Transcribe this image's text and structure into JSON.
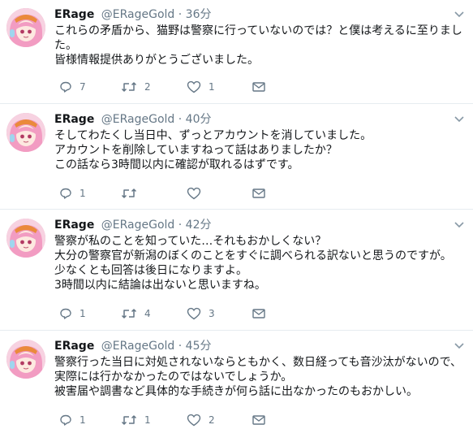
{
  "tweets": [
    {
      "name": "ERage",
      "handle": "@ERageGold",
      "dot": "·",
      "time": "36分",
      "lines": [
        "これらの矛盾から、猫野は警察に行っていないのでは？と僕は考えるに至りまし",
        "た。",
        "皆様情報提供ありがとうございました。"
      ],
      "replies": "7",
      "retweets": "2",
      "likes": "1"
    },
    {
      "name": "ERage",
      "handle": "@ERageGold",
      "dot": "·",
      "time": "40分",
      "lines": [
        "そしてわたくし当日中、ずっとアカウントを消していました。",
        "アカウントを削除していますねって話はありましたか？",
        "この話なら3時間以内に確認が取れるはずです。"
      ],
      "replies": "1",
      "retweets": "",
      "likes": ""
    },
    {
      "name": "ERage",
      "handle": "@ERageGold",
      "dot": "·",
      "time": "42分",
      "lines": [
        "警察が私のことを知っていた…それもおかしくない？",
        "大分の警察官が新潟のぼくのことをすぐに調べられる訳ないと思うのですが。",
        "少なくとも回答は後日になりますよ。",
        "3時間以内に結論は出ないと思いますね。"
      ],
      "replies": "1",
      "retweets": "4",
      "likes": "3"
    },
    {
      "name": "ERage",
      "handle": "@ERageGold",
      "dot": "·",
      "time": "45分",
      "lines": [
        "警察行った当日に対処されないならともかく、数日経っても音沙汰がないので、",
        "実際には行かなかったのではないでしょうか。",
        "被害届や調書など具体的な手続きが何ら話に出なかったのもおかしい。"
      ],
      "replies": "1",
      "retweets": "1",
      "likes": "2"
    }
  ],
  "icons": {
    "reply": "reply-icon",
    "retweet": "retweet-icon",
    "like": "heart-icon",
    "dm": "envelope-icon",
    "caret": "chevron-down-icon",
    "avatar": "avatar-anime-girl"
  },
  "colors": {
    "text": "#14171a",
    "secondary": "#657786",
    "divider": "#e6ecf0",
    "avatar_hair": "#f3a2c4",
    "avatar_hat": "#e8813a"
  }
}
